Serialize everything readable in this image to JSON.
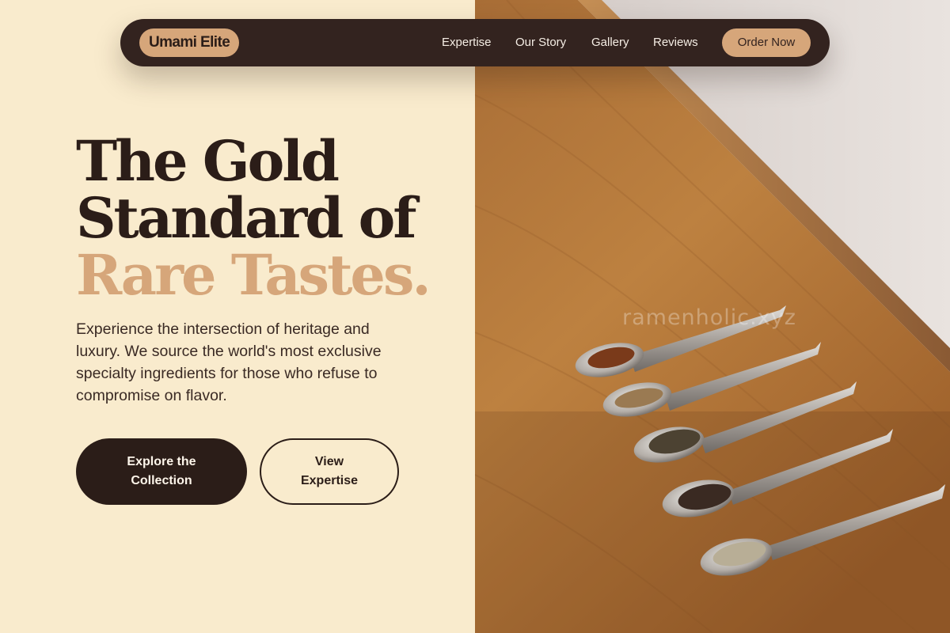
{
  "nav": {
    "logo": "Umami Elite",
    "links": [
      "Expertise",
      "Our Story",
      "Gallery",
      "Reviews"
    ],
    "cta": "Order Now"
  },
  "hero": {
    "headline_line1": "The Gold",
    "headline_line2": "Standard of",
    "headline_accent": "Rare Tastes.",
    "subtext": "Experience the intersection of heritage and luxury. We source the world's most exclusive specialty ingredients for those who refuse to compromise on flavor.",
    "primary_button": "Explore the Collection",
    "secondary_button": "View Expertise"
  },
  "image": {
    "watermark": "ramenholic.xyz"
  },
  "colors": {
    "background": "#f9ebcd",
    "dark": "#2b1d18",
    "nav_bg": "#33231f",
    "accent": "#d6a67a"
  }
}
